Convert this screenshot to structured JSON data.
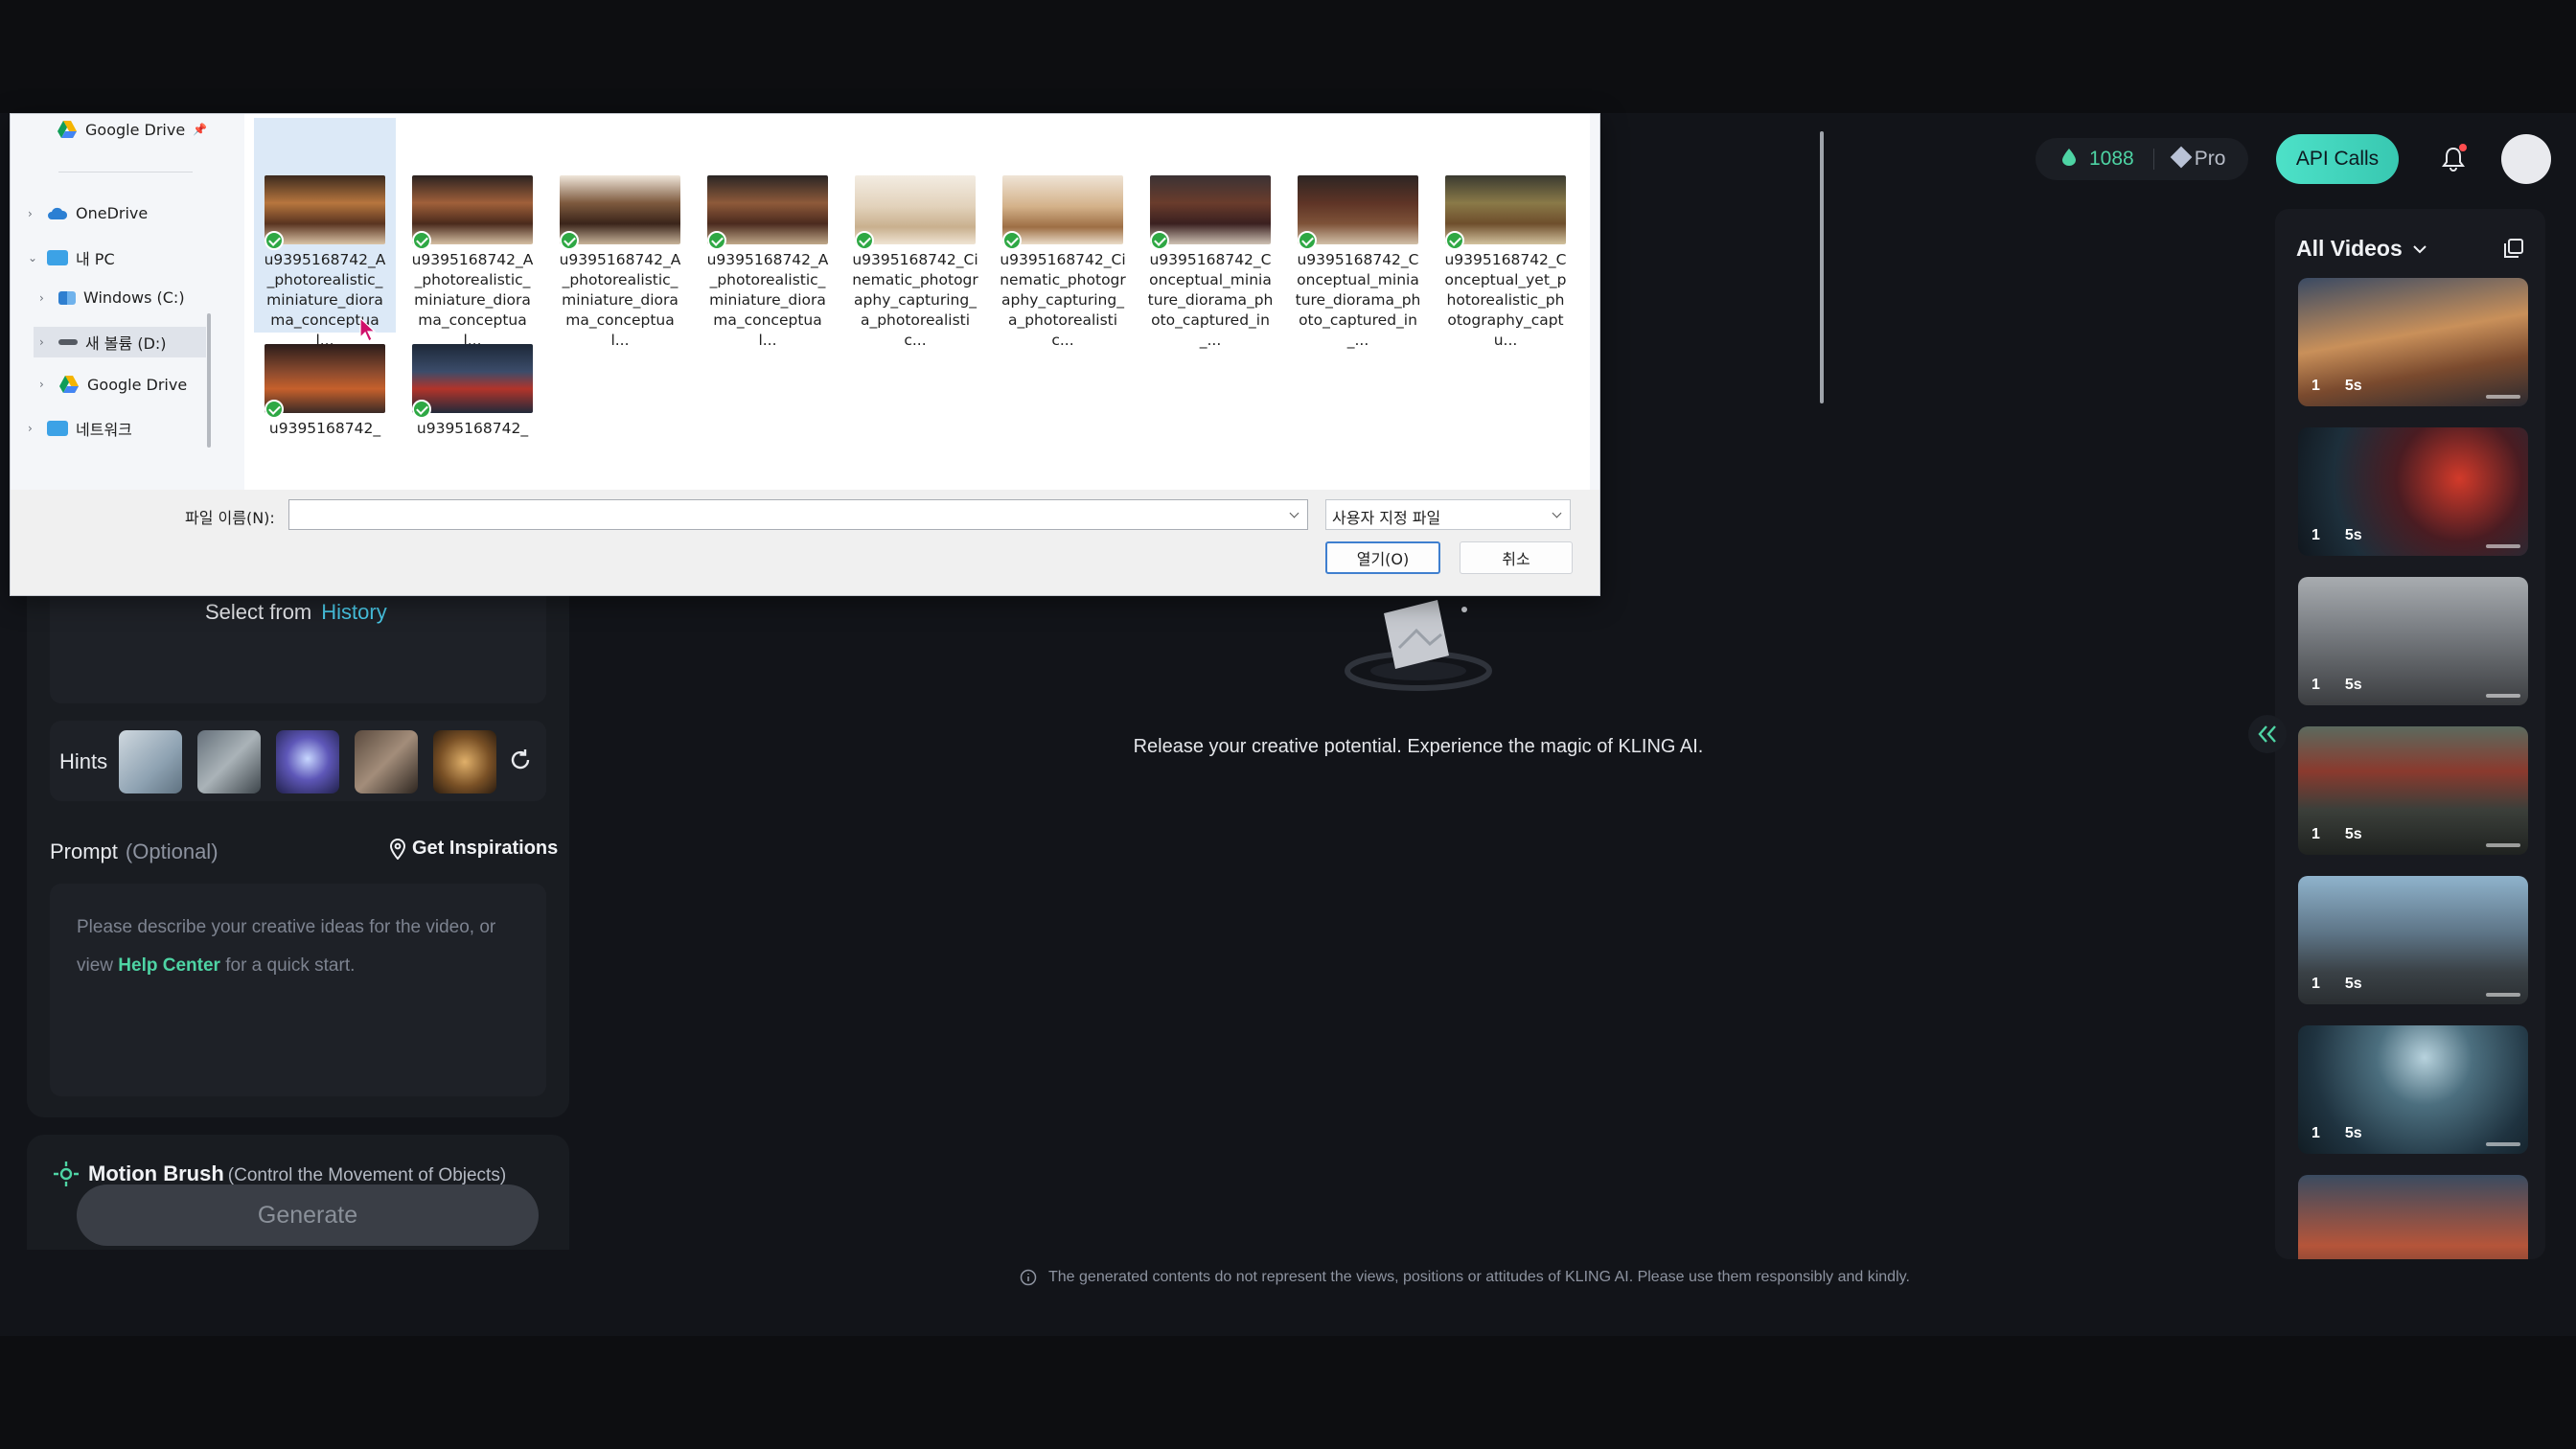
{
  "topbar": {
    "credits": "1088",
    "plan": "Pro",
    "api_button": "API Calls"
  },
  "rail": {
    "title": "All Videos",
    "videos": [
      {
        "count": "1",
        "duration": "5s"
      },
      {
        "count": "1",
        "duration": "5s"
      },
      {
        "count": "1",
        "duration": "5s"
      },
      {
        "count": "1",
        "duration": "5s"
      },
      {
        "count": "1",
        "duration": "5s"
      },
      {
        "count": "1",
        "duration": "5s"
      }
    ]
  },
  "left_panel": {
    "select_from": "Select from",
    "history_link": "History",
    "hints_label": "Hints",
    "prompt_label": "Prompt",
    "prompt_optional": "(Optional)",
    "inspirations": "Get Inspirations",
    "prompt_text_1": "Please describe your creative ideas for the video, or view",
    "prompt_help": "Help Center",
    "prompt_text_2": "for a quick start.",
    "motion_brush": "Motion Brush",
    "motion_brush_desc": "(Control the Movement of Objects)",
    "generate": "Generate"
  },
  "center": {
    "message": "Release your creative potential. Experience the magic of KLING AI.",
    "disclaimer": "The generated contents do not represent the views, positions or attitudes of KLING AI. Please use them responsibly and kindly."
  },
  "dialog": {
    "nav": {
      "google_drive_pinned": "Google Drive",
      "onedrive": "OneDrive",
      "this_pc": "내 PC",
      "windows_c": "Windows (C:)",
      "new_volume_d": "새 볼륨 (D:)",
      "google_drive": "Google Drive",
      "network": "네트워크"
    },
    "files": [
      "u9395168742_A_photorealistic_miniature_diorama_conceptual...",
      "u9395168742_A_photorealistic_miniature_diorama_conceptual...",
      "u9395168742_A_photorealistic_miniature_diorama_conceptual...",
      "u9395168742_A_photorealistic_miniature_diorama_conceptual...",
      "u9395168742_Cinematic_photography_capturing_a_photorealistic...",
      "u9395168742_Cinematic_photography_capturing_a_photorealistic...",
      "u9395168742_Conceptual_miniature_diorama_photo_captured_in_...",
      "u9395168742_Conceptual_miniature_diorama_photo_captured_in_...",
      "u9395168742_Conceptual_yet_photorealistic_photography_captu...",
      "u9395168742_",
      "u9395168742_"
    ],
    "filename_label": "파일 이름(N):",
    "filename_value": "",
    "filetype": "사용자 지정 파일",
    "open_button": "열기(O)",
    "cancel_button": "취소"
  },
  "colors": {
    "accent": "#4ed4a4",
    "link": "#49c9e8",
    "api_button": "#3fd4bd",
    "background": "#121419"
  }
}
